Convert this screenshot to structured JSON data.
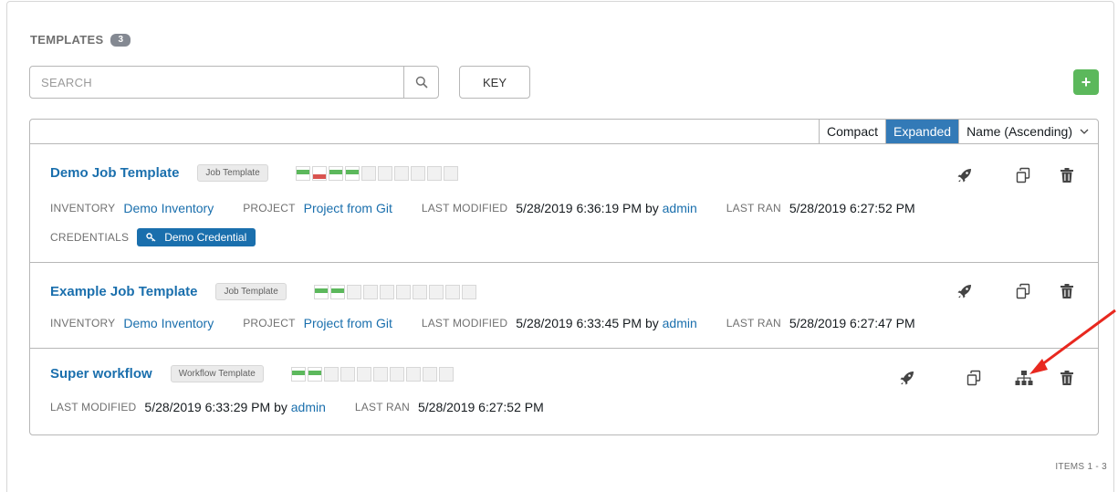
{
  "header": {
    "title": "TEMPLATES",
    "count": "3"
  },
  "search": {
    "placeholder": "SEARCH"
  },
  "toolbar": {
    "key_label": "KEY",
    "add_label": "+"
  },
  "view": {
    "compact": "Compact",
    "expanded": "Expanded",
    "sort": "Name (Ascending)"
  },
  "labels": {
    "inventory": "INVENTORY",
    "project": "PROJECT",
    "last_modified": "LAST MODIFIED",
    "last_ran": "LAST RAN",
    "credentials": "CREDENTIALS",
    "by": "by"
  },
  "templates": [
    {
      "name": "Demo Job Template",
      "type": "Job Template",
      "jobs": [
        "ok",
        "fail",
        "ok",
        "ok",
        "none",
        "none",
        "none",
        "none",
        "none",
        "none"
      ],
      "inventory": "Demo Inventory",
      "project": "Project from Git",
      "modified": "5/28/2019 6:36:19 PM",
      "modified_by": "admin",
      "last_ran": "5/28/2019 6:27:52 PM",
      "credential": "Demo Credential"
    },
    {
      "name": "Example Job Template",
      "type": "Job Template",
      "jobs": [
        "ok",
        "ok",
        "none",
        "none",
        "none",
        "none",
        "none",
        "none",
        "none",
        "none"
      ],
      "inventory": "Demo Inventory",
      "project": "Project from Git",
      "modified": "5/28/2019 6:33:45 PM",
      "modified_by": "admin",
      "last_ran": "5/28/2019 6:27:47 PM"
    },
    {
      "name": "Super workflow",
      "type": "Workflow Template",
      "jobs": [
        "ok",
        "ok",
        "none",
        "none",
        "none",
        "none",
        "none",
        "none",
        "none",
        "none"
      ],
      "modified": "5/28/2019 6:33:29 PM",
      "modified_by": "admin",
      "last_ran": "5/28/2019 6:27:52 PM"
    }
  ],
  "footer": {
    "items": "ITEMS  1 - 3"
  },
  "colors": {
    "link": "#1a6fad",
    "success": "#5cb85c",
    "failed": "#d9534f",
    "active": "#337ab7",
    "annotation": "#e8281f"
  },
  "icons": [
    "search-icon",
    "rocket-icon",
    "copy-icon",
    "delete-icon",
    "workflow-visualizer-icon",
    "key-icon",
    "chevron-down-icon"
  ]
}
